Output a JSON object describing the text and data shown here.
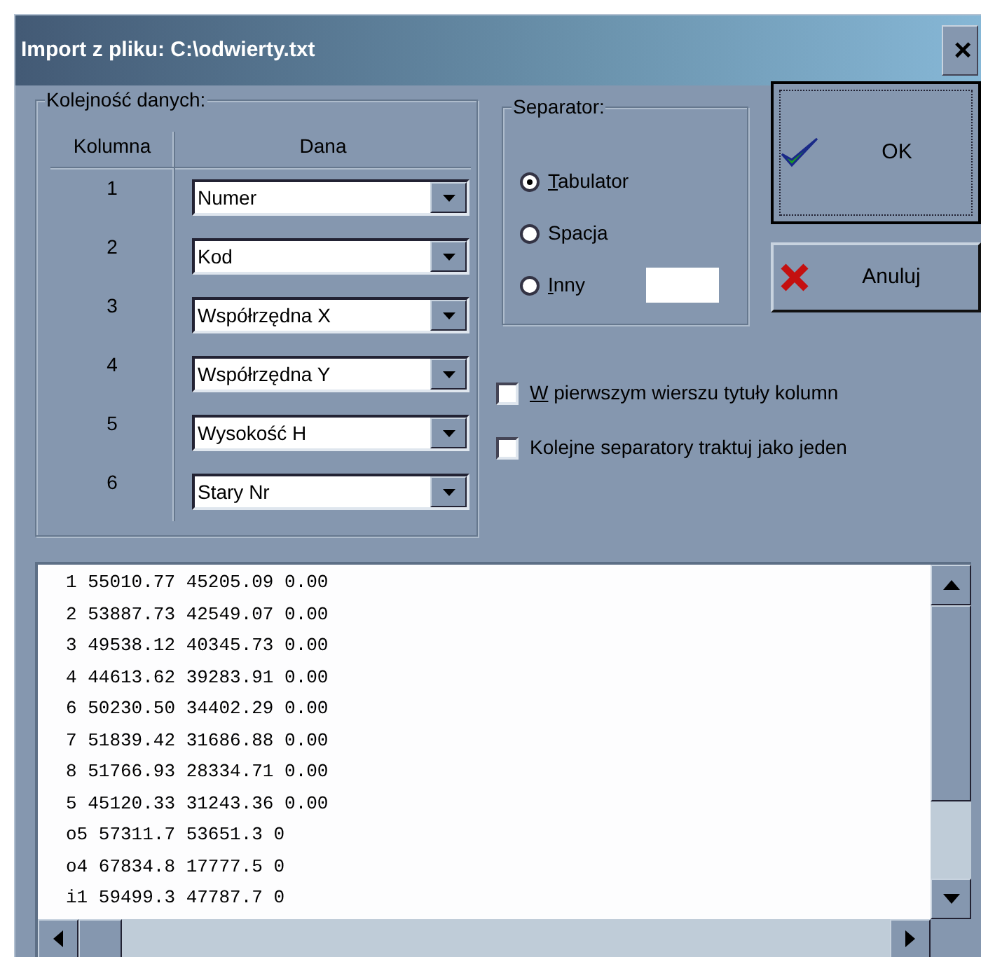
{
  "window": {
    "title": "Import z pliku: C:\\odwierty.txt",
    "close": "×"
  },
  "order_group": {
    "legend": "Kolejność danych:",
    "columns": [
      "Kolumna",
      "Dana"
    ],
    "rows": [
      {
        "column": "1",
        "value": "Numer"
      },
      {
        "column": "2",
        "value": "Kod"
      },
      {
        "column": "3",
        "value": "Współrzędna X"
      },
      {
        "column": "4",
        "value": "Współrzędna Y"
      },
      {
        "column": "5",
        "value": "Wysokość H"
      },
      {
        "column": "6",
        "value": "Stary Nr"
      }
    ]
  },
  "separator_group": {
    "legend": "Separator:",
    "options": [
      {
        "label": "Tabulator",
        "selected": true,
        "underline_first": true,
        "kind": "plain"
      },
      {
        "label": "Spacja",
        "selected": false,
        "underline_first": false,
        "kind": "plain"
      },
      {
        "label": "Inny",
        "selected": false,
        "underline_first": true,
        "kind": "with-field"
      }
    ]
  },
  "buttons": [
    {
      "label": "OK",
      "kind": "ok",
      "default": true
    },
    {
      "label": "Anuluj",
      "kind": "cancel",
      "default": false
    }
  ],
  "checkboxes": [
    {
      "label": "W pierwszym wierszu tytuły kolumn",
      "checked": false,
      "underline_first": true
    },
    {
      "label": "Kolejne separatory traktuj jako jeden",
      "checked": false,
      "underline_first": false
    }
  ],
  "preview_lines": [
    "1 55010.77 45205.09 0.00",
    "2 53887.73 42549.07 0.00",
    "3 49538.12 40345.73 0.00",
    "4 44613.62 39283.91 0.00",
    "6 50230.50 34402.29 0.00",
    "7 51839.42 31686.88 0.00",
    "8 51766.93 28334.71 0.00",
    "5 45120.33 31243.36 0.00",
    "o5 57311.7 53651.3 0",
    "o4 67834.8 17777.5 0",
    "i1 59499.3 47787.7 0"
  ]
}
